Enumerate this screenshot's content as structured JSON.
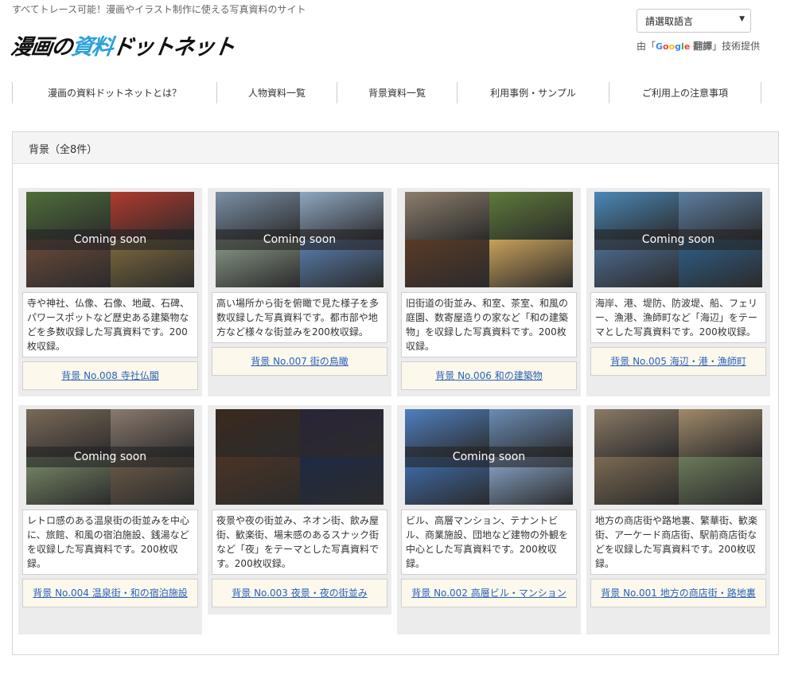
{
  "header": {
    "tagline": "すべてトレース可能！漫画やイラスト制作に使える写真資料のサイト",
    "logo_a": "漫画の",
    "logo_b": "資料",
    "logo_c": "ドットネット",
    "lang_select": "請選取語言",
    "powered_prefix": "由「",
    "powered_google": [
      "G",
      "o",
      "o",
      "g",
      "l",
      "e"
    ],
    "powered_translate": "翻譯",
    "powered_suffix": "」技術提供"
  },
  "nav": [
    "漫画の資料ドットネットとは？",
    "人物資料一覧",
    "背景資料一覧",
    "利用事例・サンプル",
    "ご利用上の注意事項"
  ],
  "panel": {
    "title": "背景（全8件）"
  },
  "overlay_text": "Coming soon",
  "cards": [
    {
      "desc": "寺や神社、仏像、石像、地蔵、石碑、パワースポットなど歴史ある建築物などを多数収録した写真資料です。200枚収録。",
      "link": "背景 No.008 寺社仏閣",
      "overlay": true,
      "colors": [
        "#4f6e3a",
        "#b03a2e",
        "#6b4a3a",
        "#7d6a3e"
      ]
    },
    {
      "desc": "高い場所から街を俯瞰で見た様子を多数収録した写真資料です。都市部や地方など様々な街並みを200枚収録。",
      "link": "背景 No.007 街の鳥瞰",
      "overlay": true,
      "colors": [
        "#7b8fa6",
        "#8fa7c2",
        "#8a9a88",
        "#5a7fb0"
      ]
    },
    {
      "desc": "旧街道の街並み、和室、茶室、和風の庭園、数寄屋造りの家など「和の建築物」を収録した写真資料です。200枚収録。",
      "link": "背景 No.006 和の建築物",
      "overlay": false,
      "colors": [
        "#8c7e6c",
        "#5f7a3a",
        "#5a3a26",
        "#c8a05a"
      ]
    },
    {
      "desc": "海岸、港、堤防、防波堤、船、フェリー、漁港、漁師町など「海辺」をテーマとした写真資料です。200枚収録。",
      "link": "背景 No.005 海辺・港・漁師町",
      "overlay": true,
      "colors": [
        "#4a88b8",
        "#5c7ea0",
        "#4f6f96",
        "#2f5f88"
      ]
    },
    {
      "desc": "レトロ感のある温泉街の街並みを中心に、旅館、和風の宿泊施設、銭湯などを収録した写真資料です。200枚収録。",
      "link": "背景 No.004 温泉街・和の宿泊施設",
      "overlay": true,
      "colors": [
        "#7a6a58",
        "#8a7a6e",
        "#7a8c6a",
        "#6b5b4a"
      ]
    },
    {
      "desc": "夜景や夜の街並み、ネオン街、飲み屋街、歓楽街、場末感のあるスナック街など「夜」をテーマとした写真資料です。200枚収録。",
      "link": "背景 No.003 夜景・夜の街並み",
      "overlay": false,
      "colors": [
        "#3a2a1e",
        "#2a2438",
        "#4a3426",
        "#1e2a44"
      ]
    },
    {
      "desc": "ビル、高層マンション、テナントビル、商業施設、団地など建物の外観を中心とした写真資料です。200枚収録。",
      "link": "背景 No.002 高層ビル・マンション",
      "overlay": true,
      "colors": [
        "#4f7fc0",
        "#6a8cb4",
        "#3f6fb0",
        "#8aa8cc"
      ]
    },
    {
      "desc": "地方の商店街や路地裏、繁華街、歓楽街、アーケード商店街、駅前商店街などを収録した写真資料です。200枚収録。",
      "link": "背景 No.001 地方の商店街・路地裏",
      "overlay": false,
      "colors": [
        "#8a7a66",
        "#a08a6a",
        "#7a6a52",
        "#6a7a5a"
      ]
    }
  ]
}
